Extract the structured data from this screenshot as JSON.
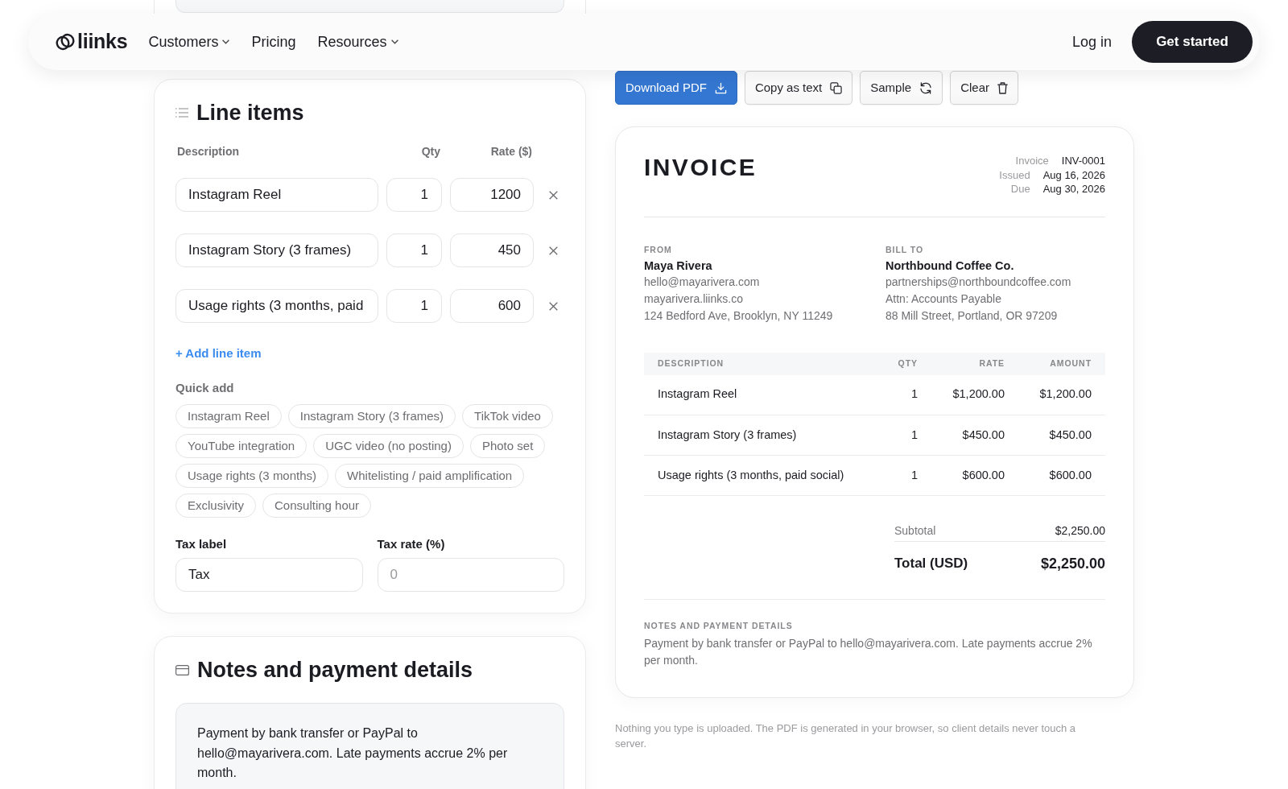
{
  "nav": {
    "logo": "liinks",
    "links": [
      {
        "label": "Customers",
        "has_menu": true
      },
      {
        "label": "Pricing",
        "has_menu": false
      },
      {
        "label": "Resources",
        "has_menu": true
      }
    ],
    "login": "Log in",
    "cta": "Get started"
  },
  "line_items": {
    "title": "Line items",
    "columns": [
      "Description",
      "Qty",
      "Rate ($)"
    ],
    "rows": [
      {
        "description": "Instagram Reel",
        "qty": "1",
        "rate": "1200"
      },
      {
        "description": "Instagram Story (3 frames)",
        "qty": "1",
        "rate": "450"
      },
      {
        "description": "Usage rights (3 months, paid",
        "qty": "1",
        "rate": "600"
      }
    ],
    "add_button": "+ Add line item",
    "quick_add": {
      "label": "Quick add",
      "chips": [
        "Instagram Reel",
        "Instagram Story (3 frames)",
        "TikTok video",
        "YouTube integration",
        "UGC video (no posting)",
        "Photo set",
        "Usage rights (3 months)",
        "Whitelisting / paid amplification",
        "Exclusivity",
        "Consulting hour"
      ]
    },
    "tax_label": {
      "label": "Tax label",
      "value": "Tax"
    },
    "tax_rate": {
      "label": "Tax rate (%)",
      "placeholder": "0"
    }
  },
  "notes": {
    "title": "Notes and payment details",
    "value": "Payment by bank transfer or PayPal to hello@mayarivera.com. Late payments accrue 2% per month."
  },
  "toolbar": [
    {
      "label": "Download PDF",
      "primary": true
    },
    {
      "label": "Copy as text",
      "primary": false
    },
    {
      "label": "Sample",
      "primary": false
    },
    {
      "label": "Clear",
      "primary": false
    }
  ],
  "invoice": {
    "title": "INVOICE",
    "meta": [
      {
        "label": "Invoice",
        "value": "INV-0001"
      },
      {
        "label": "Issued",
        "value": "Aug 16, 2026"
      },
      {
        "label": "Due",
        "value": "Aug 30, 2026"
      }
    ],
    "from": {
      "label": "FROM",
      "name": "Maya Rivera",
      "lines": [
        "hello@mayarivera.com",
        "mayarivera.liinks.co",
        "124 Bedford Ave, Brooklyn, NY 11249"
      ]
    },
    "bill_to": {
      "label": "BILL TO",
      "name": "Northbound Coffee Co.",
      "lines": [
        "partnerships@northboundcoffee.com",
        "Attn: Accounts Payable",
        "88 Mill Street, Portland, OR 97209"
      ]
    },
    "table": {
      "columns": [
        "DESCRIPTION",
        "QTY",
        "RATE",
        "AMOUNT"
      ],
      "rows": [
        [
          "Instagram Reel",
          "1",
          "$1,200.00",
          "$1,200.00"
        ],
        [
          "Instagram Story (3 frames)",
          "1",
          "$450.00",
          "$450.00"
        ],
        [
          "Usage rights (3 months, paid social)",
          "1",
          "$600.00",
          "$600.00"
        ]
      ]
    },
    "subtotal": {
      "label": "Subtotal",
      "value": "$2,250.00"
    },
    "total": {
      "label": "Total (USD)",
      "value": "$2,250.00"
    },
    "notes": {
      "label": "NOTES AND PAYMENT DETAILS",
      "text": "Payment by bank transfer or PayPal to hello@mayarivera.com. Late payments accrue 2% per month."
    }
  },
  "footer_note": "Nothing you type is uploaded. The PDF is generated in your browser, so client details never touch a server."
}
